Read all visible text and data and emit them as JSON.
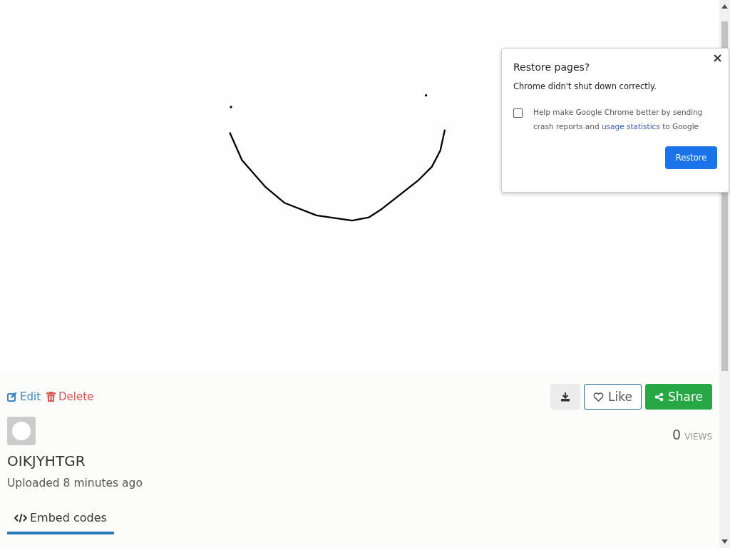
{
  "post": {
    "actions": [
      {
        "kind": "edit",
        "label": "Edit"
      },
      {
        "kind": "delete",
        "label": "Delete"
      }
    ],
    "buttons": [
      {
        "kind": "download"
      },
      {
        "kind": "like",
        "label": "Like"
      },
      {
        "kind": "share",
        "label": "Share"
      }
    ],
    "views_count": "0",
    "views_label": "VIEWS",
    "title": "OIKJYHTGR",
    "uploaded": "Uploaded 8 minutes ago",
    "tabs": [
      {
        "label": "Embed codes",
        "selected": true
      }
    ]
  },
  "dialog": {
    "title": "Restore pages?",
    "message": "Chrome didn't shut down correctly.",
    "checkbox": {
      "checked": false,
      "text_before": "Help make Google Chrome better by sending crash reports and ",
      "link": "usage statistics",
      "text_after": " to Google"
    },
    "button": "Restore"
  }
}
